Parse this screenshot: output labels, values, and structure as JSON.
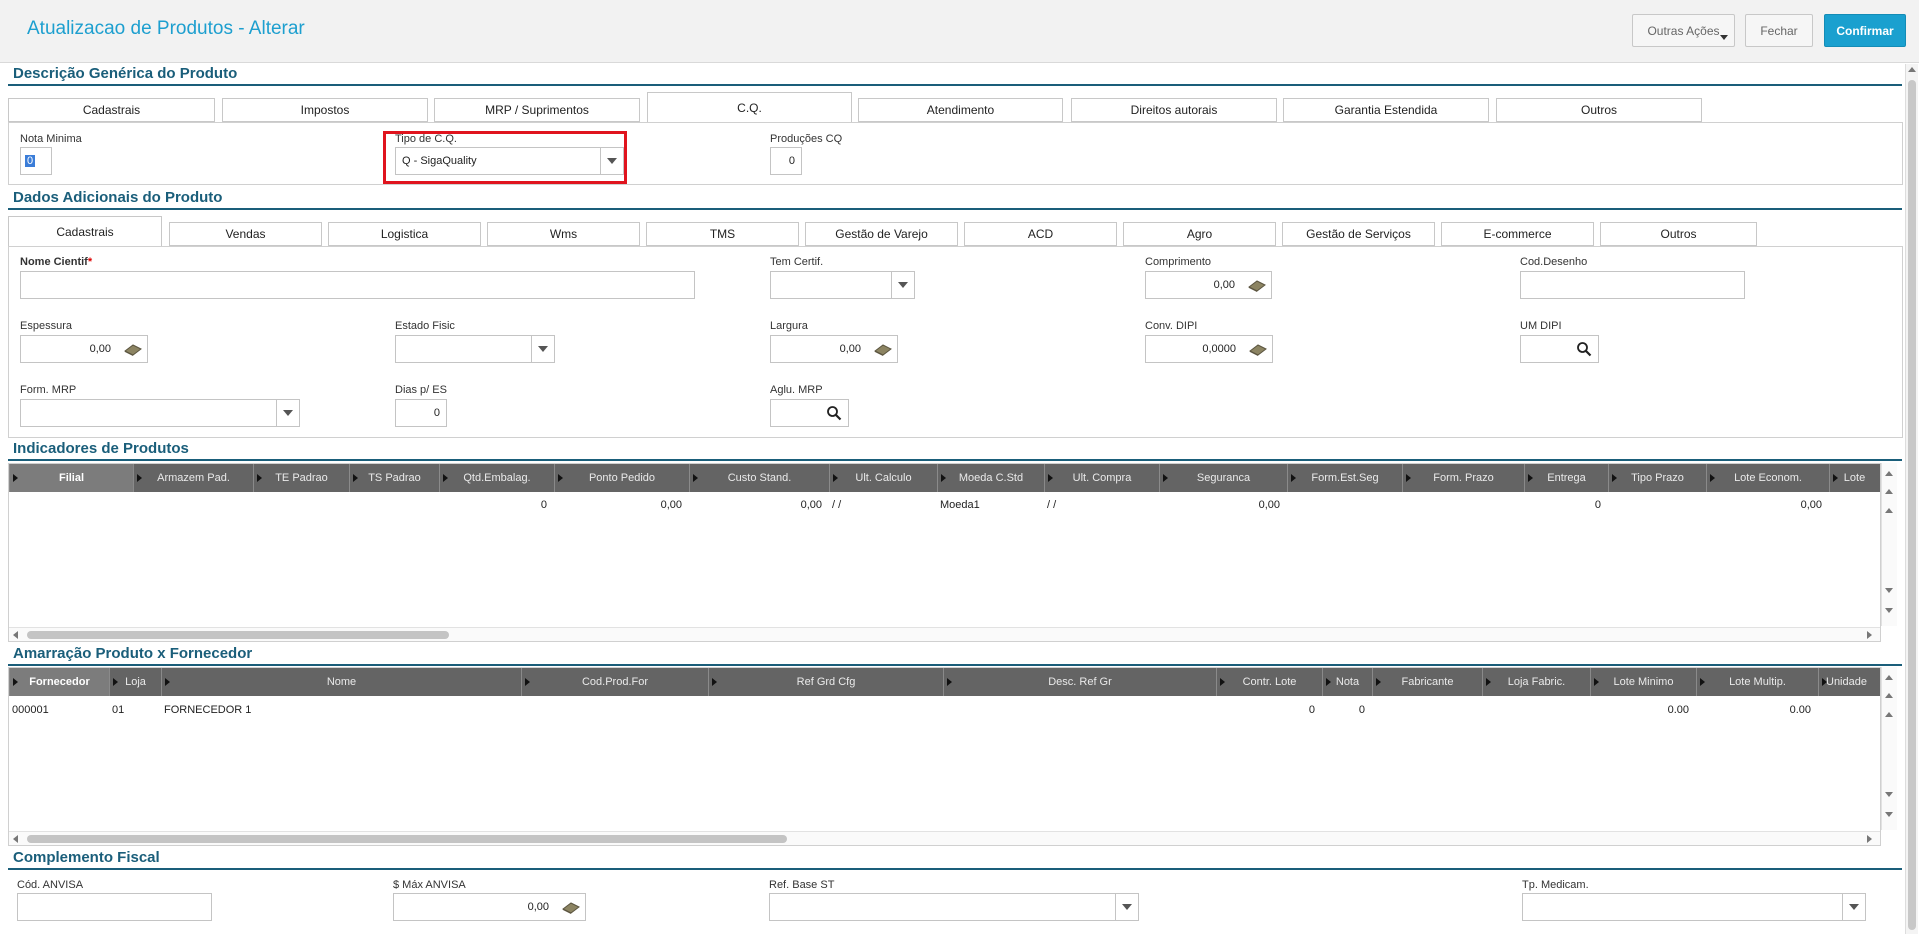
{
  "header": {
    "title": "Atualizacao de Produtos - Alterar",
    "buttons": {
      "outras_acoes": "Outras Ações",
      "fechar": "Fechar",
      "confirmar": "Confirmar"
    }
  },
  "sections": {
    "descricao": "Descrição Genérica do Produto",
    "dados": "Dados Adicionais do Produto",
    "indicadores": "Indicadores de Produtos",
    "amarracao": "Amarração Produto x Fornecedor",
    "complemento": "Complemento Fiscal"
  },
  "tabs1": [
    "Cadastrais",
    "Impostos",
    "MRP / Suprimentos",
    "C.Q.",
    "Atendimento",
    "Direitos autorais",
    "Garantia Estendida",
    "Outros"
  ],
  "cq": {
    "nota_minima_label": "Nota Minima",
    "nota_minima_value": "0",
    "tipo_cq_label": "Tipo de C.Q.",
    "tipo_cq_value": "Q - SigaQuality",
    "producoes_label": "Produções CQ",
    "producoes_value": "0"
  },
  "tabs2": [
    "Cadastrais",
    "Vendas",
    "Logistica",
    "Wms",
    "TMS",
    "Gestão de Varejo",
    "ACD",
    "Agro",
    "Gestão de Serviços",
    "E-commerce",
    "Outros"
  ],
  "dados": {
    "nome_cientif_label": "Nome Cientif",
    "tem_certif_label": "Tem Certif.",
    "comprimento_label": "Comprimento",
    "comprimento_value": "0,00",
    "cod_desenho_label": "Cod.Desenho",
    "espessura_label": "Espessura",
    "espessura_value": "0,00",
    "estado_fisic_label": "Estado Fisic",
    "largura_label": "Largura",
    "largura_value": "0,00",
    "conv_dipi_label": "Conv. DIPI",
    "conv_dipi_value": "0,0000",
    "um_dipi_label": "UM DIPI",
    "form_mrp_label": "Form. MRP",
    "dias_es_label": "Dias p/ ES",
    "dias_es_value": "0",
    "aglu_mrp_label": "Aglu. MRP"
  },
  "indicadores": {
    "columns": [
      "Filial",
      "Armazem Pad.",
      "TE Padrao",
      "TS Padrao",
      "Qtd.Embalag.",
      "Ponto Pedido",
      "Custo Stand.",
      "Ult. Calculo",
      "Moeda C.Std",
      "Ult. Compra",
      "Seguranca",
      "Form.Est.Seg",
      "Form. Prazo",
      "Entrega",
      "Tipo Prazo",
      "Lote Econom.",
      "Lote"
    ],
    "row": [
      "",
      "",
      "",
      "",
      "0",
      "0,00",
      "0,00",
      "/  /",
      "Moeda1",
      "/  /",
      "0,00",
      "",
      "",
      "0",
      "",
      "0,00",
      ""
    ]
  },
  "amarracao": {
    "columns": [
      "Fornecedor",
      "Loja",
      "Nome",
      "Cod.Prod.For",
      "Ref Grd Cfg",
      "Desc. Ref Gr",
      "Contr. Lote",
      "Nota",
      "Fabricante",
      "Loja Fabric.",
      "Lote Minimo",
      "Lote Multip.",
      "Unidade"
    ],
    "row": [
      "000001",
      "01",
      "FORNECEDOR 1",
      "",
      "",
      "",
      "0",
      "0",
      "",
      "",
      "0.00",
      "0.00",
      ""
    ]
  },
  "complemento": {
    "cod_anvisa_label": "Cód. ANVISA",
    "max_anvisa_label": "$ Máx ANVISA",
    "max_anvisa_value": "0,00",
    "ref_base_st_label": "Ref. Base ST",
    "tp_medicam_label": "Tp. Medicam."
  },
  "colors": {
    "accent": "#1aa0cf",
    "section": "#1a5e7a",
    "highlight": "#e0141e"
  }
}
